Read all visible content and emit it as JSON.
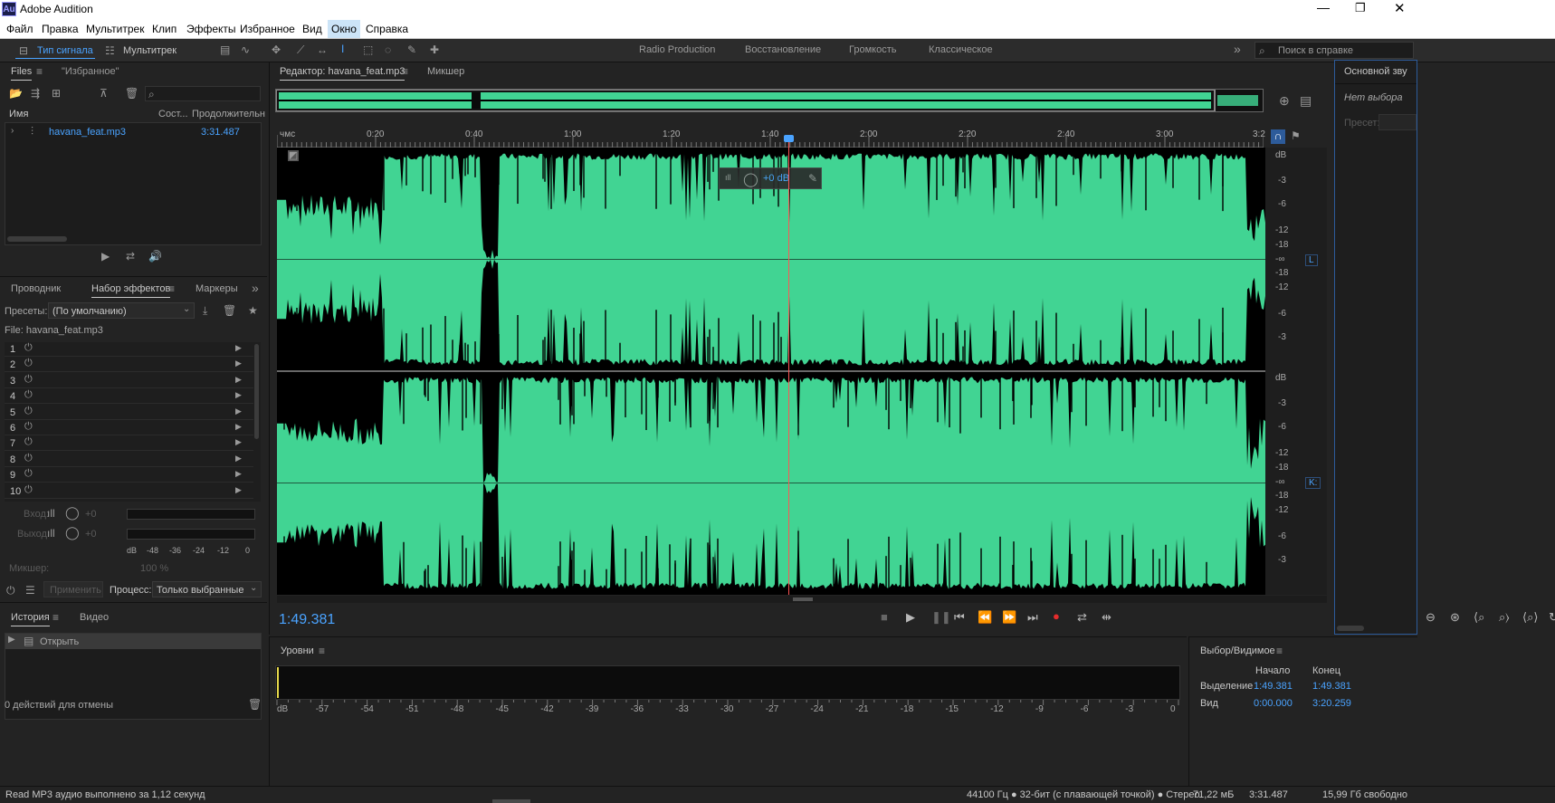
{
  "title": "Adobe Audition",
  "app_icon": "Au",
  "menu": [
    "Файл",
    "Правка",
    "Мультитрек",
    "Клип",
    "Эффекты",
    "Избранное",
    "Вид",
    "Окно",
    "Справка"
  ],
  "toolbar": {
    "waveform_label": "Тип сигнала",
    "multitrack_label": "Мультитрек",
    "workspaces": [
      "Radio Production",
      "Восстановление",
      "Громкость",
      "Классическое"
    ],
    "search_placeholder": "Поиск в справке"
  },
  "files_panel": {
    "tab_files": "Files",
    "tab_favorites": "\"Избранное\"",
    "col_name": "Имя",
    "col_status": "Сост...",
    "col_duration": "Продолжительн",
    "file_name": "havana_feat.mp3",
    "file_duration": "3:31.487"
  },
  "effects_panel": {
    "tab_explorer": "Проводник",
    "tab_rack": "Набор эффектов",
    "tab_markers": "Маркеры",
    "presets_label": "Пресеты:",
    "preset_value": "(По умолчанию)",
    "file_label": "File: havana_feat.mp3",
    "slots": [
      "1",
      "2",
      "3",
      "4",
      "5",
      "6",
      "7",
      "8",
      "9",
      "10"
    ],
    "input_label": "Вход:",
    "output_label": "Выход:",
    "input_value": "+0",
    "output_value": "+0",
    "meter_scale": [
      "dB",
      "-48",
      "-36",
      "-24",
      "-12",
      "0"
    ],
    "mix_label": "Микшер:",
    "mix_value": "100 %",
    "apply_label": "Применить",
    "process_label": "Процесс:",
    "process_value": "Только выбранные"
  },
  "history_panel": {
    "tab_history": "История",
    "tab_video": "Видео",
    "item": "Открыть",
    "undo_count": "0 действий для отмены"
  },
  "editor": {
    "tab_editor": "Редактор: havana_feat.mp3",
    "tab_mixer": "Микшер",
    "ruler_unit": "чмс",
    "ruler_labels": [
      "0:20",
      "0:40",
      "1:00",
      "1:20",
      "1:40",
      "2:00",
      "2:20",
      "2:40",
      "3:00",
      "3:2"
    ],
    "gain_value": "+0 dB",
    "db_labels": [
      "dB",
      "-3",
      "-6",
      "-12",
      "-18",
      "-∞",
      "-18",
      "-12",
      "-6",
      "-3"
    ],
    "channel_l": "L",
    "channel_r": "K:",
    "current_time": "1:49.381",
    "playhead_fraction": 0.517
  },
  "levels_panel": {
    "title": "Уровни",
    "scale": [
      "dB",
      "-57",
      "-54",
      "-51",
      "-48",
      "-45",
      "-42",
      "-39",
      "-36",
      "-33",
      "-30",
      "-27",
      "-24",
      "-21",
      "-18",
      "-15",
      "-12",
      "-9",
      "-6",
      "-3",
      "0"
    ]
  },
  "selection_panel": {
    "title": "Выбор/Видимое",
    "col_start": "Начало",
    "col_end": "Конец",
    "row_selection": "Выделение",
    "row_view": "Вид",
    "sel_start": "1:49.381",
    "sel_end": "1:49.381",
    "view_start": "0:00.000",
    "view_end": "3:20.259"
  },
  "right_panel": {
    "title": "Основной зву",
    "no_selection": "Нет выбора",
    "preset_label": "Пресет:"
  },
  "status": {
    "message": "Read MP3 аудио выполнено за 1,12 секунд",
    "format": "44100 Гц ● 32-бит (с плавающей точкой) ● Стерео",
    "size": "71,22 мБ",
    "duration": "3:31.487",
    "free": "15,99 Гб свободно"
  },
  "colors": {
    "wave": "#41d493",
    "accent": "#4aa3ff",
    "bg": "#232323"
  }
}
